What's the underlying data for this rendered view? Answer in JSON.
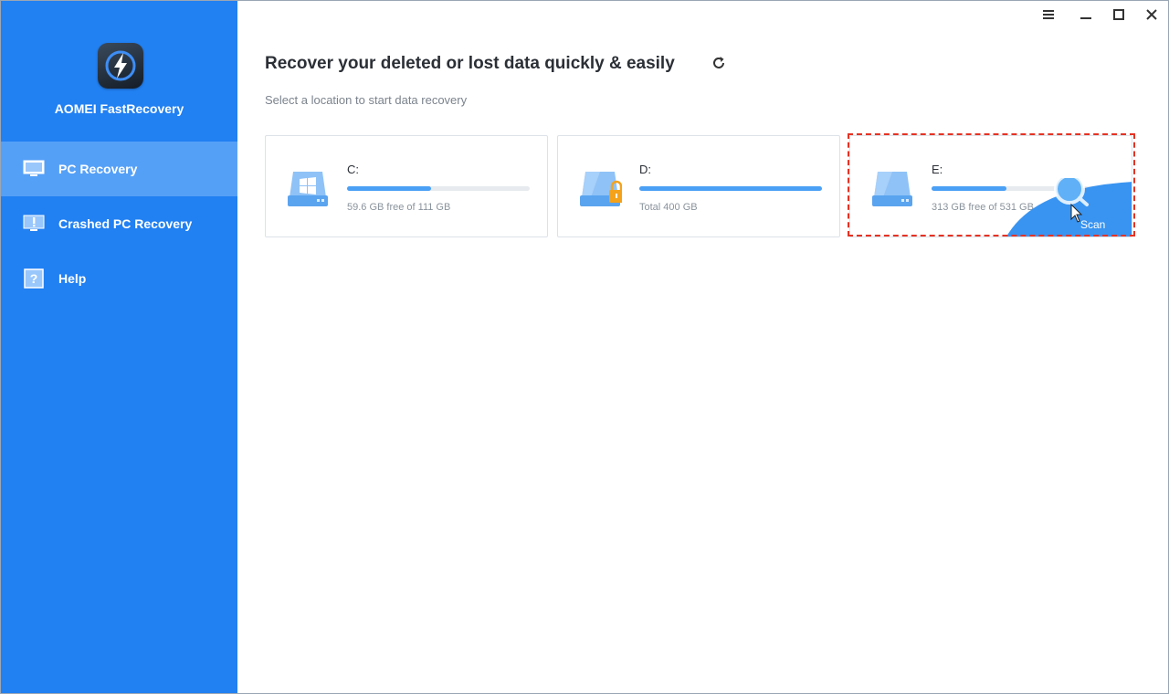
{
  "app": {
    "name": "AOMEI FastRecovery"
  },
  "sidebar": {
    "items": [
      {
        "label": "PC Recovery",
        "icon": "monitor-icon",
        "active": true
      },
      {
        "label": "Crashed PC Recovery",
        "icon": "warning-monitor-icon",
        "active": false
      },
      {
        "label": "Help",
        "icon": "help-icon",
        "active": false
      }
    ]
  },
  "window_controls": [
    "menu-icon",
    "minimize-icon",
    "maximize-icon",
    "close-icon"
  ],
  "main": {
    "title": "Recover your deleted or lost data quickly & easily",
    "subtitle": "Select a location to start data recovery",
    "drives": [
      {
        "name": "C:",
        "info": "59.6 GB free of 111 GB",
        "used_fraction": 0.46,
        "icon": "windows-drive-icon"
      },
      {
        "name": "D:",
        "info": "Total 400 GB",
        "used_fraction": 1.0,
        "icon": "locked-drive-icon"
      },
      {
        "name": "E:",
        "info": "313 GB free of 531 GB",
        "used_fraction": 0.41,
        "icon": "drive-icon",
        "hover_action": "Scan"
      }
    ]
  },
  "colors": {
    "sidebar": "#2180f2",
    "sidebar_active": "#55a0f7",
    "accent": "#4aa0f5",
    "highlight": "#e53223"
  }
}
